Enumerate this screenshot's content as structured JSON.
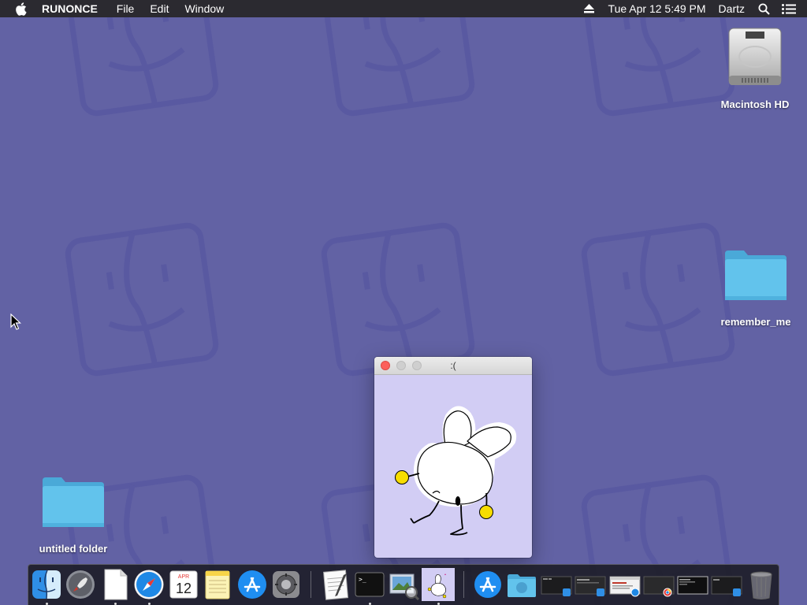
{
  "menubar": {
    "app_name": "RUNONCE",
    "menus": [
      "File",
      "Edit",
      "Window"
    ],
    "clock": "Tue Apr 12  5:49 PM",
    "user": "Dartz"
  },
  "desktop": {
    "icons": [
      {
        "label": "Macintosh HD",
        "type": "drive"
      },
      {
        "label": "remember_me",
        "type": "folder"
      },
      {
        "label": "untitled folder",
        "type": "folder"
      }
    ]
  },
  "window": {
    "title": ":("
  },
  "dock": {
    "items": [
      {
        "name": "finder-icon",
        "running": true
      },
      {
        "name": "launchpad-icon",
        "running": false
      },
      {
        "name": "textedit-document-icon",
        "running": true
      },
      {
        "name": "safari-icon",
        "running": true
      },
      {
        "name": "calendar-icon",
        "running": false,
        "month": "APR",
        "day": "12"
      },
      {
        "name": "notes-icon",
        "running": false
      },
      {
        "name": "app-store-icon",
        "running": false
      },
      {
        "name": "system-preferences-icon",
        "running": false
      },
      {
        "name": "textedit-icon",
        "running": false
      },
      {
        "name": "terminal-icon",
        "running": true
      },
      {
        "name": "preview-icon",
        "running": false
      },
      {
        "name": "runonce-app-icon",
        "running": true
      },
      {
        "name": "app-store-download-icon",
        "running": false
      },
      {
        "name": "downloads-folder-icon",
        "running": false
      },
      {
        "name": "minimized-window-1",
        "running": false
      },
      {
        "name": "minimized-window-2",
        "running": false
      },
      {
        "name": "minimized-window-3",
        "running": false
      },
      {
        "name": "minimized-window-4",
        "running": false
      },
      {
        "name": "minimized-window-5",
        "running": false
      },
      {
        "name": "minimized-window-6",
        "running": false
      },
      {
        "name": "trash-icon",
        "running": false
      }
    ]
  },
  "colors": {
    "desktop_bg": "#6262a4",
    "menubar_bg": "#2b2a30",
    "window_content_bg": "#d2cdf4",
    "bunny_accent": "#f7dd00",
    "folder_blue": "#5bc0ea"
  }
}
